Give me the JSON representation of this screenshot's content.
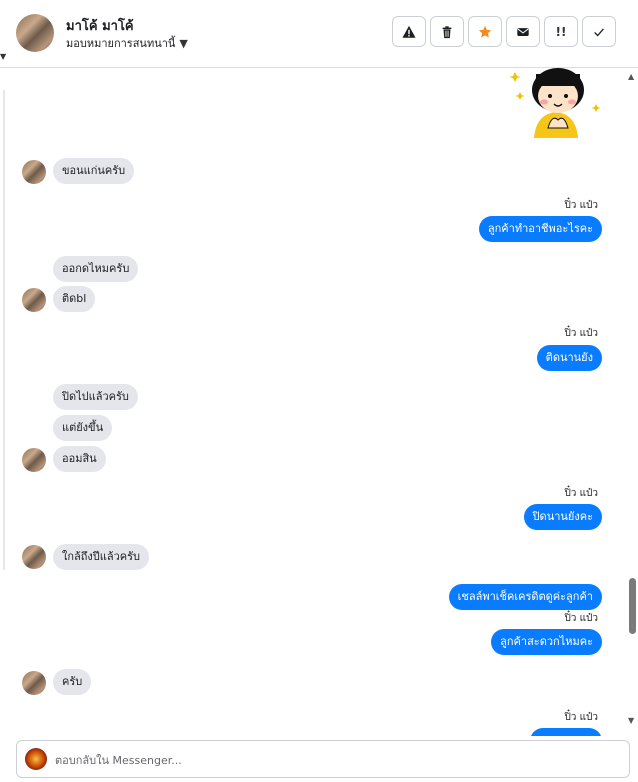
{
  "header": {
    "name": "มาโค้ มาโค้",
    "assign_label": "มอบหมายการสนทนานี้",
    "actions": [
      {
        "icon": "warning-icon"
      },
      {
        "icon": "trash-icon"
      },
      {
        "icon": "star-icon"
      },
      {
        "icon": "mail-icon"
      },
      {
        "icon": "spam-icon",
        "label": "!!"
      },
      {
        "icon": "check-icon"
      }
    ]
  },
  "messages": {
    "m1": "ขอนแก่นครับ",
    "s1": "ปิ๋ว แป๋ว",
    "m2": "ลูกค้าทำอาชีพอะไรคะ",
    "m3": "ออกดไหมครับ",
    "m4": "ติดbl",
    "s2": "ปิ๋ว แป๋ว",
    "m5": "ติดนานยัง",
    "m6": "ปิดไปแล้วครับ",
    "m7": "แต่ยังขึ้น",
    "m8": "ออมสิน",
    "s3": "ปิ๋ว แป๋ว",
    "m9": "ปิดนานยังคะ",
    "m10": "ใกล้ถึงปีแล้วครับ",
    "m11": "เชลล์พาเช็คเครดิตดูค่ะลูกค้า",
    "s4": "ปิ๋ว แป๋ว",
    "m12": "ลูกค้าสะดวกไหมคะ",
    "m13": "ครับ",
    "s5": "ปิ๋ว แป๋ว"
  },
  "composer": {
    "placeholder": "ตอบกลับใน Messenger..."
  },
  "colors": {
    "outgoing_bubble": "#0a7cff",
    "incoming_bubble": "#e4e6eb",
    "star": "#f28b20"
  }
}
